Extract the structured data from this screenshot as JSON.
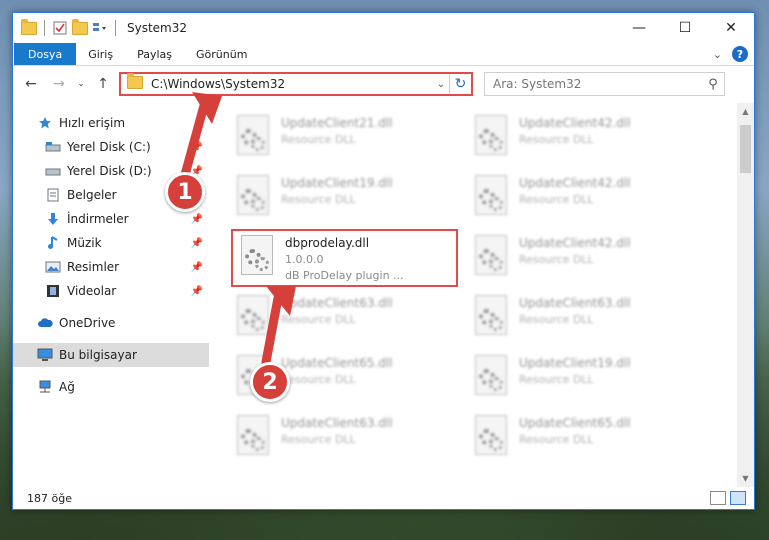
{
  "window": {
    "title": "System32",
    "controls": {
      "minimize": "—",
      "maximize": "☐",
      "close": "✕"
    }
  },
  "ribbon": {
    "tabs": [
      "Dosya",
      "Giriş",
      "Paylaş",
      "Görünüm"
    ],
    "help": "?"
  },
  "navigation": {
    "address": "C:\\Windows\\System32",
    "search_placeholder": "Ara: System32"
  },
  "sidebar": {
    "items": [
      {
        "label": "Hızlı erişim",
        "icon": "star-icon"
      },
      {
        "label": "Yerel Disk (C:)",
        "icon": "drive-icon",
        "pinned": true
      },
      {
        "label": "Yerel Disk (D:)",
        "icon": "drive-icon",
        "pinned": true
      },
      {
        "label": "Belgeler",
        "icon": "documents-icon",
        "pinned": true
      },
      {
        "label": "İndirmeler",
        "icon": "download-icon",
        "pinned": true
      },
      {
        "label": "Müzik",
        "icon": "music-icon",
        "pinned": true
      },
      {
        "label": "Resimler",
        "icon": "pictures-icon",
        "pinned": true
      },
      {
        "label": "Videolar",
        "icon": "videos-icon",
        "pinned": true
      },
      {
        "label": "OneDrive",
        "icon": "cloud-icon"
      },
      {
        "label": "Bu bilgisayar",
        "icon": "computer-icon",
        "selected": true
      },
      {
        "label": "Ağ",
        "icon": "network-icon"
      }
    ]
  },
  "files": [
    {
      "name": "UpdateClient21.dll",
      "desc": "Resource DLL"
    },
    {
      "name": "UpdateClient42.dll",
      "desc": "Resource DLL"
    },
    {
      "name": "UpdateClient19.dll",
      "desc": "Resource DLL"
    },
    {
      "name": "UpdateClient42.dll",
      "desc": "Resource DLL"
    },
    {
      "name": "dbprodelay.dll",
      "version": "1.0.0.0",
      "desc": "dB ProDelay plugin ...",
      "highlighted": true
    },
    {
      "name": "UpdateClient42.dll",
      "desc": "Resource DLL"
    },
    {
      "name": "UpdateClient63.dll",
      "desc": "Resource DLL"
    },
    {
      "name": "UpdateClient63.dll",
      "desc": "Resource DLL"
    },
    {
      "name": "UpdateClient65.dll",
      "desc": "Resource DLL"
    },
    {
      "name": "UpdateClient19.dll",
      "desc": "Resource DLL"
    },
    {
      "name": "UpdateClient63.dll",
      "desc": "Resource DLL"
    },
    {
      "name": "UpdateClient65.dll",
      "desc": "Resource DLL"
    }
  ],
  "status": {
    "count": "187 öğe"
  },
  "annotations": {
    "step1": "1",
    "step2": "2"
  },
  "colors": {
    "accent": "#1979ca",
    "highlight": "#e14b4b",
    "badge": "#d6403b"
  }
}
